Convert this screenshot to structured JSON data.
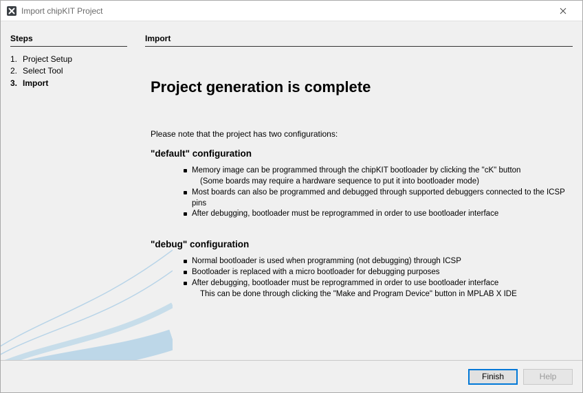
{
  "window": {
    "title": "Import chipKIT Project"
  },
  "left": {
    "heading": "Steps",
    "steps": [
      {
        "num": "1.",
        "label": "Project Setup"
      },
      {
        "num": "2.",
        "label": "Select Tool"
      },
      {
        "num": "3.",
        "label": "Import"
      }
    ],
    "current_index": 2
  },
  "main": {
    "section_heading": "Import",
    "title": "Project generation is complete",
    "note": "Please note that the project has two configurations:",
    "default_config": {
      "heading": "\"default\" configuration",
      "items": [
        {
          "text": "Memory image can be programmed through the chipKIT bootloader by clicking the \"cK\" button",
          "sub": "(Some boards may require a hardware sequence to put it into bootloader mode)"
        },
        {
          "text": "Most boards can also be programmed and debugged through supported debuggers connected to the ICSP pins"
        },
        {
          "text": "After debugging, bootloader must be reprogrammed in order to use bootloader interface"
        }
      ]
    },
    "debug_config": {
      "heading": "\"debug\" configuration",
      "items": [
        {
          "text": "Normal bootloader is used when programming (not debugging) through ICSP"
        },
        {
          "text": "Bootloader is replaced with a micro bootloader for debugging purposes"
        },
        {
          "text": "After debugging, bootloader must be reprogrammed in order to use bootloader interface",
          "sub": "This can be done through clicking the \"Make and Program Device\" button in MPLAB X IDE"
        }
      ]
    }
  },
  "footer": {
    "finish": "Finish",
    "help": "Help"
  }
}
